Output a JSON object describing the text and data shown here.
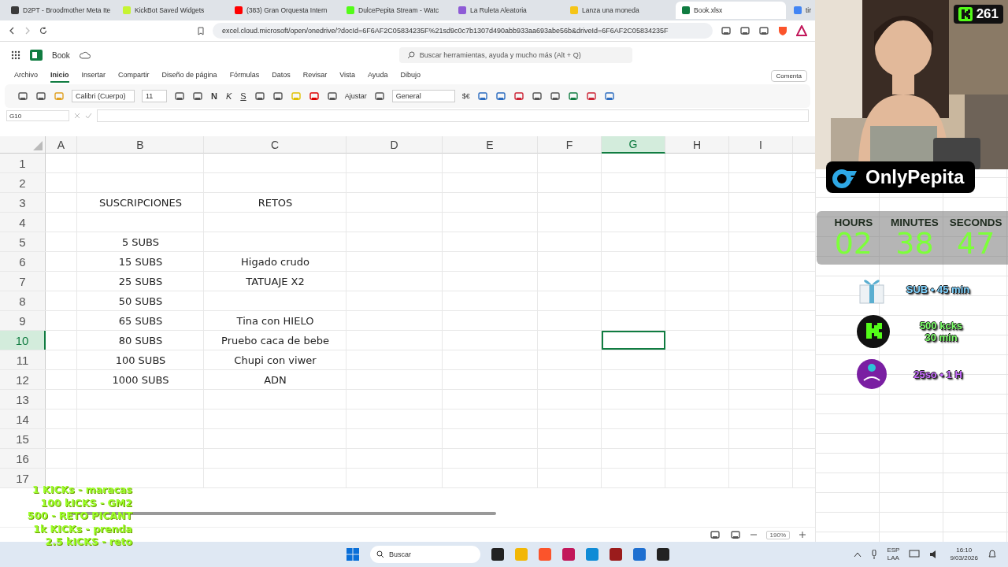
{
  "browser": {
    "tabs": [
      {
        "title": "D2PT - Broodmother Meta Ite",
        "selected": false
      },
      {
        "title": "KickBot Saved Widgets",
        "selected": false
      },
      {
        "title": "(383) Gran Orquesta Intern",
        "selected": false
      },
      {
        "title": "DulcePepita Stream - Watc",
        "selected": false
      },
      {
        "title": "La Ruleta Aleatoria",
        "selected": false
      },
      {
        "title": "Lanza una moneda",
        "selected": false
      },
      {
        "title": "Book.xlsx",
        "selected": true
      },
      {
        "title": "tir",
        "selected": false
      }
    ],
    "url": "excel.cloud.microsoft/open/onedrive/?docId=6F6AF2C05834235F%21sd9c0c7b1307d490abb933aa693abe56b&driveId=6F6AF2C05834235F"
  },
  "excel": {
    "file_name": "Book",
    "search": {
      "placeholder": "Buscar herramientas, ayuda y mucho más (Alt + Q)"
    },
    "menu": [
      {
        "label": "Archivo",
        "selected": false
      },
      {
        "label": "Inicio",
        "selected": true
      },
      {
        "label": "Insertar",
        "selected": false
      },
      {
        "label": "Compartir",
        "selected": false
      },
      {
        "label": "Diseño de página",
        "selected": false
      },
      {
        "label": "Fórmulas",
        "selected": false
      },
      {
        "label": "Datos",
        "selected": false
      },
      {
        "label": "Revisar",
        "selected": false
      },
      {
        "label": "Vista",
        "selected": false
      },
      {
        "label": "Ayuda",
        "selected": false
      },
      {
        "label": "Dibujo",
        "selected": false
      }
    ],
    "comments_button": "Comenta",
    "ribbon": {
      "font": "Calibri (Cuerpo)",
      "size": "11",
      "format_buttons": [
        "N",
        "K",
        "S"
      ],
      "wrap": "Ajustar",
      "number_format": "General",
      "currency": "$€"
    },
    "name_box": "G10",
    "columns": [
      {
        "label": "A",
        "selected": false
      },
      {
        "label": "B",
        "selected": false
      },
      {
        "label": "C",
        "selected": false
      },
      {
        "label": "D",
        "selected": false
      },
      {
        "label": "E",
        "selected": false
      },
      {
        "label": "F",
        "selected": false
      },
      {
        "label": "G",
        "selected": true
      },
      {
        "label": "H",
        "selected": false
      },
      {
        "label": "I",
        "selected": false
      }
    ],
    "rows": [
      {
        "number": "1",
        "selected": false
      },
      {
        "number": "2",
        "selected": false
      },
      {
        "number": "3",
        "selected": false,
        "b": "SUSCRIPCIONES",
        "c": "RETOS"
      },
      {
        "number": "4",
        "selected": false
      },
      {
        "number": "5",
        "selected": false,
        "b": "5 SUBS"
      },
      {
        "number": "6",
        "selected": false,
        "b": "15 SUBS",
        "c": "Higado crudo"
      },
      {
        "number": "7",
        "selected": false,
        "b": "25 SUBS",
        "c": "TATUAJE X2"
      },
      {
        "number": "8",
        "selected": false,
        "b": "50 SUBS"
      },
      {
        "number": "9",
        "selected": false,
        "b": "65 SUBS",
        "c": "Tina con HIELO"
      },
      {
        "number": "10",
        "selected": true,
        "b": "80 SUBS",
        "c": "Pruebo caca de bebe"
      },
      {
        "number": "11",
        "selected": false,
        "b": "100 SUBS",
        "c": "Chupi con viwer"
      },
      {
        "number": "12",
        "selected": false,
        "b": "1000 SUBS",
        "c": "ADN"
      },
      {
        "number": "13",
        "selected": false
      },
      {
        "number": "14",
        "selected": false
      },
      {
        "number": "15",
        "selected": false
      },
      {
        "number": "16",
        "selected": false
      },
      {
        "number": "17",
        "selected": false
      }
    ],
    "zoom": "190%"
  },
  "overlay": {
    "kick_count": "261",
    "channel_name": "OnlyPepita",
    "timer": [
      {
        "label": "HOURS",
        "value": "02"
      },
      {
        "label": "MINUTES",
        "value": "38"
      },
      {
        "label": "SECONDS",
        "value": "47"
      }
    ],
    "rewards": [
      {
        "kind": "gift",
        "text": "SUB • 45 min",
        "color": "#7fd3ff"
      },
      {
        "kind": "kick",
        "text": "500 kcks\n30 min",
        "color": "#7dff6a"
      },
      {
        "kind": "yape",
        "text": "25so • 1 H",
        "color": "#c86bff"
      }
    ],
    "kick_goals": [
      "1 KICKs - maracas",
      "100 kICKS - GM2",
      "500 - RETO PICANT",
      "1k KICKs - prenda",
      "2.5 kICKS - reto"
    ]
  },
  "taskbar": {
    "search_placeholder": "Buscar",
    "language": "ESP",
    "layout": "LAA",
    "time": "16:10",
    "date": "9/03/2026"
  }
}
